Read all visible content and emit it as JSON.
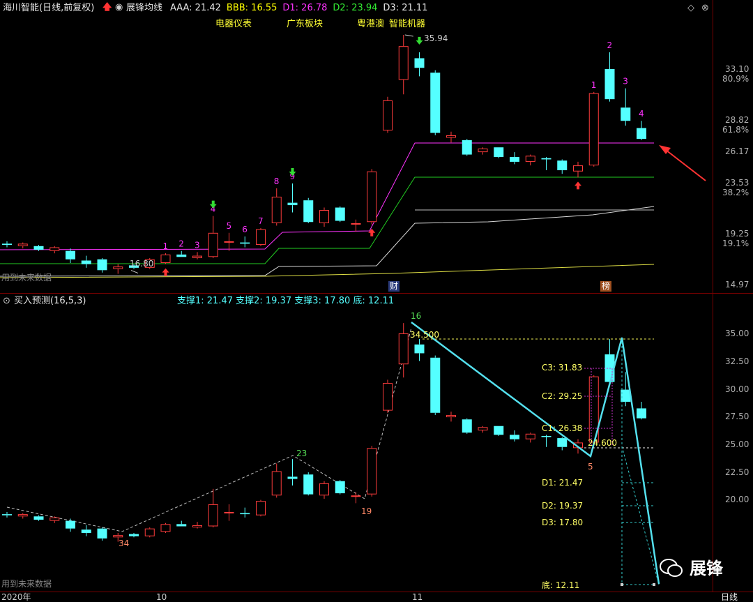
{
  "upper": {
    "title": "海川智能(日线,前复权)",
    "indicator_name": "展锋均线",
    "values": [
      {
        "label": "AAA: 21.42",
        "color": "#e8e8e8"
      },
      {
        "label": "BBB: 16.55",
        "color": "#ffff00"
      },
      {
        "label": "D1: 26.78",
        "color": "#ff33ff"
      },
      {
        "label": "D2: 23.94",
        "color": "#33ee33"
      },
      {
        "label": "D3: 21.11",
        "color": "#e8e8e8"
      }
    ],
    "tags": [
      "电器仪表",
      "广东板块",
      "粤港澳",
      "智能机器"
    ],
    "price_axis": [
      "33.10",
      "28.82",
      "26.17",
      "23.53",
      "19.25",
      "14.97"
    ],
    "pct_axis": [
      "80.9%",
      "61.8%",
      "38.2%",
      "19.1%"
    ],
    "high_label": "35.94",
    "low_label": "16.80",
    "future_note": "用到未来数据",
    "event_badges": [
      "财",
      "榜"
    ],
    "counts": [
      "1",
      "2",
      "3",
      "4",
      "5",
      "6",
      "7",
      "8",
      "9",
      "1",
      "2",
      "3",
      "4"
    ]
  },
  "lower": {
    "title": "买入预测(16,5,3)",
    "supports": "支撑1: 21.47  支撑2: 19.37  支撑3: 17.80  底: 12.11",
    "price_axis": [
      "35.00",
      "32.50",
      "30.00",
      "27.50",
      "25.00",
      "22.50",
      "20.00"
    ],
    "level_labels": [
      {
        "label": "C3: 31.83",
        "color": "#ffff66"
      },
      {
        "label": "C2: 29.25",
        "color": "#ffff66"
      },
      {
        "label": "C1: 26.38",
        "color": "#ffff66"
      },
      {
        "label": "D1: 21.47",
        "color": "#ffff66"
      },
      {
        "label": "D2: 19.37",
        "color": "#ffff66"
      },
      {
        "label": "D3: 17.80",
        "color": "#ffff66"
      },
      {
        "label": "底: 12.11",
        "color": "#ffff66"
      }
    ],
    "swing_labels": [
      "34",
      "23",
      "19",
      "16",
      "5"
    ],
    "peak_value": "34.500",
    "trough_value": "24.600",
    "future_note": "用到未来数据"
  },
  "bottom_bar": {
    "dates": [
      "2020年",
      "10",
      "11"
    ],
    "period": "日线"
  },
  "watermark": "展锋",
  "colors": {
    "up": "#ff3c3c",
    "down": "#54ffff",
    "ma_magenta": "#ff33ff",
    "ma_green": "#22cc22",
    "ma_white": "#d8d8d8",
    "ma_yellow": "#dddd44",
    "frame": "#7a0000",
    "arrow": "#ff3333"
  },
  "candles": [
    {
      "o": 18.6,
      "h": 18.8,
      "l": 18.3,
      "c": 18.5
    },
    {
      "o": 18.4,
      "h": 18.7,
      "l": 18.2,
      "c": 18.6
    },
    {
      "o": 18.4,
      "h": 18.5,
      "l": 18.0,
      "c": 18.1
    },
    {
      "o": 18.0,
      "h": 18.4,
      "l": 17.8,
      "c": 18.3
    },
    {
      "o": 18.0,
      "h": 18.2,
      "l": 17.0,
      "c": 17.3
    },
    {
      "o": 17.2,
      "h": 17.6,
      "l": 16.6,
      "c": 16.9
    },
    {
      "o": 17.3,
      "h": 17.4,
      "l": 16.2,
      "c": 16.4
    },
    {
      "o": 16.5,
      "h": 16.9,
      "l": 16.1,
      "c": 16.7
    },
    {
      "o": 16.8,
      "h": 16.9,
      "l": 16.5,
      "c": 16.6
    },
    {
      "o": 16.6,
      "h": 17.4,
      "l": 16.5,
      "c": 17.3
    },
    {
      "o": 17.0,
      "h": 17.8,
      "l": 16.9,
      "c": 17.7
    },
    {
      "o": 17.7,
      "h": 18.0,
      "l": 17.5,
      "c": 17.5
    },
    {
      "o": 17.4,
      "h": 17.9,
      "l": 17.3,
      "c": 17.6
    },
    {
      "o": 17.5,
      "h": 20.9,
      "l": 17.4,
      "c": 19.5
    },
    {
      "o": 18.8,
      "h": 19.5,
      "l": 18.0,
      "c": 18.8
    },
    {
      "o": 18.7,
      "h": 19.2,
      "l": 18.3,
      "c": 18.6
    },
    {
      "o": 18.5,
      "h": 19.9,
      "l": 18.4,
      "c": 19.8
    },
    {
      "o": 20.3,
      "h": 23.2,
      "l": 20.1,
      "c": 22.5
    },
    {
      "o": 22.0,
      "h": 23.6,
      "l": 21.2,
      "c": 21.8
    },
    {
      "o": 22.2,
      "h": 22.4,
      "l": 20.3,
      "c": 20.4
    },
    {
      "o": 20.3,
      "h": 21.6,
      "l": 20.0,
      "c": 21.4
    },
    {
      "o": 21.6,
      "h": 21.7,
      "l": 20.4,
      "c": 20.5
    },
    {
      "o": 20.2,
      "h": 20.6,
      "l": 19.6,
      "c": 20.3
    },
    {
      "o": 20.4,
      "h": 24.8,
      "l": 20.2,
      "c": 24.6
    },
    {
      "o": 28.0,
      "h": 30.8,
      "l": 27.8,
      "c": 30.5
    },
    {
      "o": 32.2,
      "h": 35.94,
      "l": 31.0,
      "c": 35.0
    },
    {
      "o": 34.0,
      "h": 34.5,
      "l": 32.5,
      "c": 33.2
    },
    {
      "o": 32.8,
      "h": 33.0,
      "l": 27.6,
      "c": 27.8
    },
    {
      "o": 27.4,
      "h": 27.9,
      "l": 27.0,
      "c": 27.6
    },
    {
      "o": 27.2,
      "h": 27.3,
      "l": 25.9,
      "c": 26.0
    },
    {
      "o": 26.2,
      "h": 26.6,
      "l": 26.0,
      "c": 26.5
    },
    {
      "o": 26.6,
      "h": 26.6,
      "l": 25.7,
      "c": 25.8
    },
    {
      "o": 25.8,
      "h": 26.2,
      "l": 25.2,
      "c": 25.4
    },
    {
      "o": 25.4,
      "h": 26.0,
      "l": 25.1,
      "c": 25.9
    },
    {
      "o": 25.7,
      "h": 25.8,
      "l": 24.7,
      "c": 25.6
    },
    {
      "o": 25.5,
      "h": 25.6,
      "l": 24.4,
      "c": 24.7
    },
    {
      "o": 24.6,
      "h": 25.4,
      "l": 24.1,
      "c": 25.1
    },
    {
      "o": 25.1,
      "h": 31.2,
      "l": 25.0,
      "c": 31.1
    },
    {
      "o": 33.1,
      "h": 34.5,
      "l": 30.4,
      "c": 30.6
    },
    {
      "o": 29.9,
      "h": 31.5,
      "l": 28.4,
      "c": 28.8
    },
    {
      "o": 28.2,
      "h": 28.8,
      "l": 27.2,
      "c": 27.3
    }
  ]
}
